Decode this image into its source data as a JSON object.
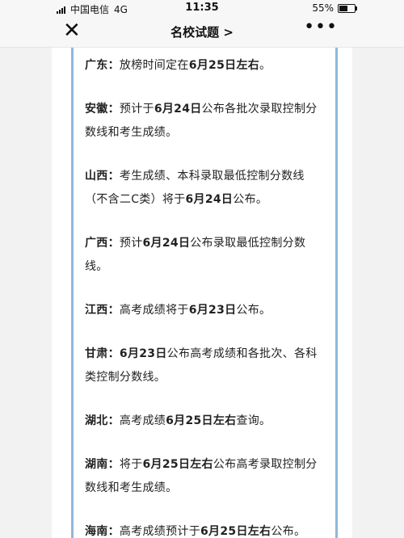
{
  "status_bar": {
    "carrier": "中国电信",
    "network": "4G",
    "time": "11:35",
    "battery": "55%",
    "battery_level": 0.55
  },
  "nav": {
    "title": "名校试题 >",
    "close_icon": "close-icon",
    "more_icon": "more-icon"
  },
  "items": [
    {
      "prov": "广东：",
      "t1": "放榜时间定在",
      "b1": "6月25日左右",
      "t2": "。",
      "b2": "",
      "t3": ""
    },
    {
      "prov": "安徽：",
      "t1": "预计于",
      "b1": "6月24日",
      "t2": "公布各批次录取控制分数线和考生成绩。",
      "b2": "",
      "t3": ""
    },
    {
      "prov": "山西：",
      "t1": "考生成绩、本科录取最低控制分数线（不含二C类）将于",
      "b1": "6月24日",
      "t2": "公布。",
      "b2": "",
      "t3": ""
    },
    {
      "prov": "广西：",
      "t1": "预计",
      "b1": "6月24日",
      "t2": "公布录取最低控制分数线。",
      "b2": "",
      "t3": ""
    },
    {
      "prov": "江西：",
      "t1": "高考成绩将于",
      "b1": "6月23日",
      "t2": "公布。",
      "b2": "",
      "t3": ""
    },
    {
      "prov": "甘肃：",
      "t1": "",
      "b1": "6月23日",
      "t2": "公布高考成绩和各批次、各科类控制分数线。",
      "b2": "",
      "t3": ""
    },
    {
      "prov": "湖北：",
      "t1": "高考成绩",
      "b1": "6月25日左右",
      "t2": "查询。",
      "b2": "",
      "t3": ""
    },
    {
      "prov": "湖南：",
      "t1": "将于",
      "b1": "6月25日左右",
      "t2": "公布高考录取控制分数线和考生成绩。",
      "b2": "",
      "t3": ""
    },
    {
      "prov": "海南：",
      "t1": "高考成绩预计于",
      "b1": "6月25日左右",
      "t2": "公布。",
      "b2": "",
      "t3": ""
    }
  ]
}
